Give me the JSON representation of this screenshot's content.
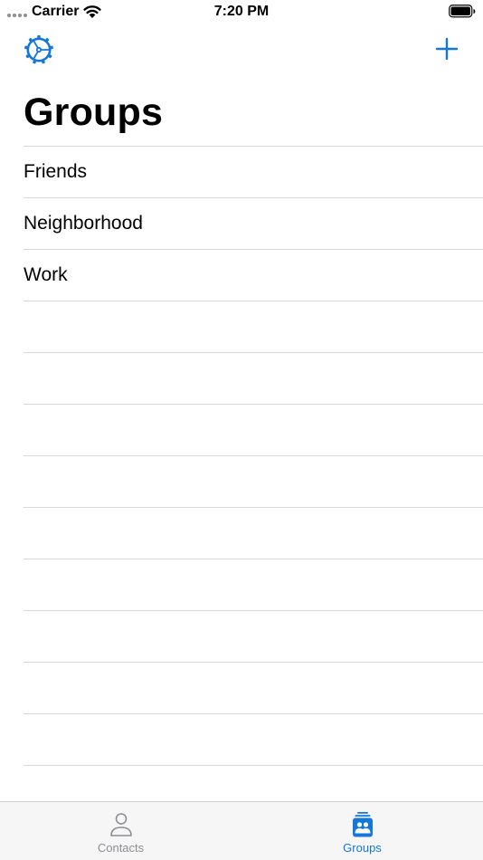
{
  "status_bar": {
    "carrier": "Carrier",
    "time": "7:20 PM"
  },
  "nav": {
    "settings_icon": "gear-icon",
    "add_icon": "plus-icon"
  },
  "page": {
    "title": "Groups"
  },
  "groups": [
    {
      "label": "Friends"
    },
    {
      "label": "Neighborhood"
    },
    {
      "label": "Work"
    }
  ],
  "tabs": [
    {
      "label": "Contacts",
      "icon": "person-icon",
      "active": false
    },
    {
      "label": "Groups",
      "icon": "groups-icon",
      "active": true
    }
  ],
  "colors": {
    "accent": "#1477d9",
    "inactive": "#8e8e93",
    "separator": "#d8d8dc"
  }
}
